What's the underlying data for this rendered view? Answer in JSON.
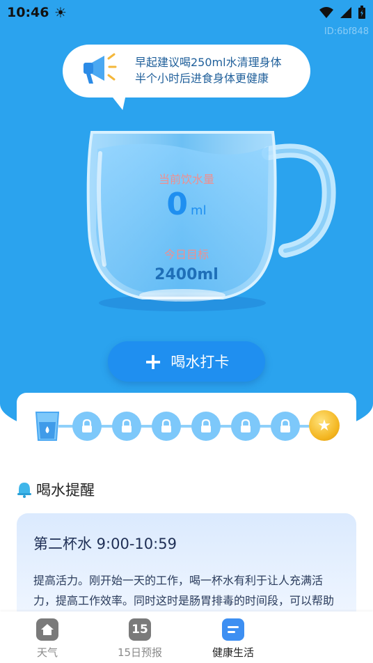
{
  "status_bar": {
    "time": "10:46"
  },
  "watermark": "ID:6bf848",
  "tip_bubble": {
    "line1": "早起建议喝250ml水清理身体",
    "line2": "半个小时后进食身体更健康"
  },
  "cup": {
    "current_label": "当前饮水量",
    "current_value": "0",
    "current_unit": "ml",
    "goal_label": "今日目标",
    "goal_value": "2400ml"
  },
  "checkin_button": {
    "icon": "plus-icon",
    "label": "喝水打卡"
  },
  "progress": {
    "filled_cups": 0,
    "total_cups": 8,
    "nodes": [
      "cup-icon",
      "lock-icon",
      "lock-icon",
      "lock-icon",
      "lock-icon",
      "lock-icon",
      "lock-icon",
      "star-icon"
    ]
  },
  "reminder": {
    "icon": "bell-icon",
    "title": "喝水提醒"
  },
  "tip_card": {
    "title": "第二杯水  9:00-10:59",
    "body": "提高活力。刚开始一天的工作，喝一杯水有利于让人充满活力，提高工作效率。同时这时是肠胃排毒的时间段，可以帮助排除体内毒素。"
  },
  "tabs": [
    {
      "label": "天气",
      "icon": "home-icon",
      "active": false
    },
    {
      "label": "15日预报",
      "icon_text": "15",
      "active": false
    },
    {
      "label": "健康生活",
      "icon": "notes-icon",
      "active": true
    }
  ],
  "colors": {
    "hero_blue": "#2ba3ee",
    "button_blue": "#1f8ff0",
    "progress_blue": "#7dc8fa",
    "gold": "#f3b51f"
  }
}
